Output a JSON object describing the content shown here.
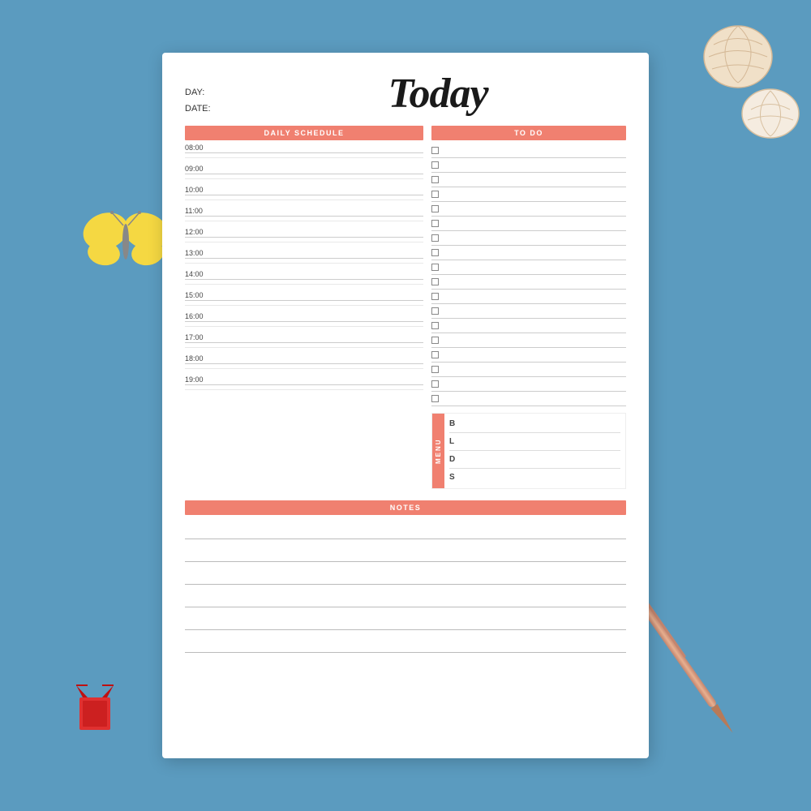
{
  "page": {
    "title": "Today",
    "day_label": "DAY:",
    "date_label": "DATE:",
    "accent_color": "#f08070"
  },
  "daily_schedule": {
    "header": "DAILY SCHEDULE",
    "times": [
      "08:00",
      "09:00",
      "10:00",
      "11:00",
      "12:00",
      "13:00",
      "14:00",
      "15:00",
      "16:00",
      "17:00",
      "18:00",
      "19:00"
    ]
  },
  "todo": {
    "header": "TO DO",
    "items": [
      "",
      "",
      "",
      "",
      "",
      "",
      "",
      "",
      "",
      "",
      "",
      "",
      "",
      "",
      "",
      "",
      "",
      ""
    ]
  },
  "menu": {
    "label": "MENU",
    "items": [
      {
        "letter": "B",
        "value": ""
      },
      {
        "letter": "L",
        "value": ""
      },
      {
        "letter": "D",
        "value": ""
      },
      {
        "letter": "S",
        "value": ""
      }
    ]
  },
  "notes": {
    "header": "NOTES",
    "line_count": 6
  }
}
